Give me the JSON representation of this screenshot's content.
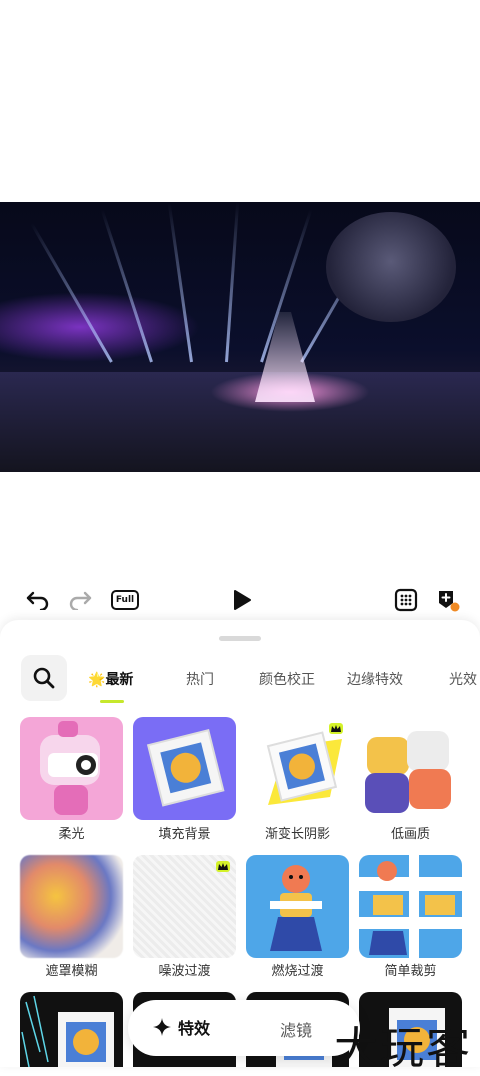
{
  "toolbar": {
    "undo_icon": "undo-icon",
    "redo_icon": "redo-icon",
    "full_label": "Full",
    "play_icon": "play-icon",
    "grid_icon": "grid-icon",
    "add_layer_icon": "add-layer-icon"
  },
  "tabs": [
    {
      "label": "最新",
      "emoji": "🌟",
      "active": true
    },
    {
      "label": "热门",
      "active": false
    },
    {
      "label": "颜色校正",
      "active": false
    },
    {
      "label": "边缘特效",
      "active": false
    },
    {
      "label": "光效",
      "active": false
    }
  ],
  "effects": [
    {
      "label": "柔光",
      "premium": false,
      "color": "#f4a6d7"
    },
    {
      "label": "填充背景",
      "premium": false,
      "color": "#7a6df5"
    },
    {
      "label": "渐变长阴影",
      "premium": true,
      "color": "#ffffff"
    },
    {
      "label": "低画质",
      "premium": false,
      "color": "#ffffff"
    },
    {
      "label": "遮罩模糊",
      "premium": false,
      "color": "#f0ece8"
    },
    {
      "label": "噪波过渡",
      "premium": true,
      "color": "#eeeeee"
    },
    {
      "label": "燃烧过渡",
      "premium": false,
      "color": "#4ea6e8"
    },
    {
      "label": "简单裁剪",
      "premium": false,
      "color": "#4ea6e8"
    }
  ],
  "bottom_bar": {
    "effects_label": "特效",
    "filters_label": "滤镜"
  },
  "watermark": "大玩客",
  "colors": {
    "accent": "#c6e82c",
    "premium_badge": "#d4f22a"
  }
}
